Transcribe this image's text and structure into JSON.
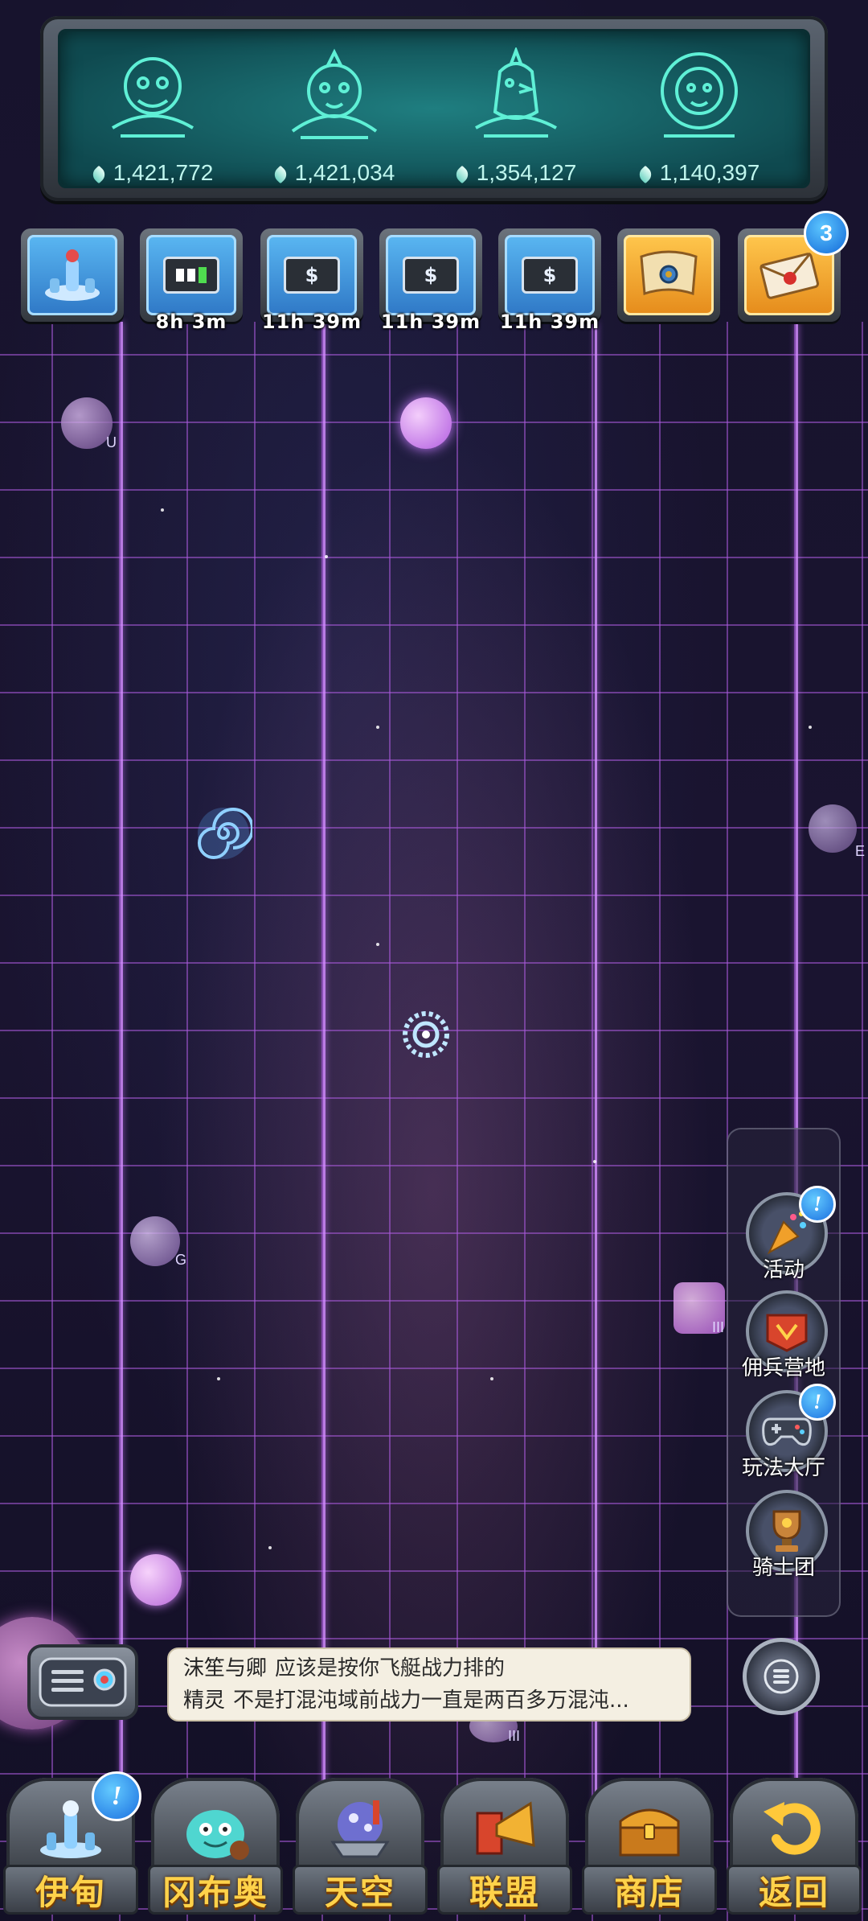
{
  "rankings": [
    {
      "emblem": "monkey-emblem",
      "power": "1,421,772"
    },
    {
      "emblem": "bear-emblem",
      "power": "1,421,034"
    },
    {
      "emblem": "bird-emblem",
      "power": "1,354,127"
    },
    {
      "emblem": "lion-emblem",
      "power": "1,140,397"
    }
  ],
  "tasks": [
    {
      "icon": "station-icon",
      "timer": ""
    },
    {
      "icon": "battery-charging-icon",
      "timer": "8h 3m"
    },
    {
      "icon": "battery-dollar-icon",
      "timer": "11h 39m",
      "symbol": "$"
    },
    {
      "icon": "battery-dollar-icon",
      "timer": "11h 39m",
      "symbol": "$"
    },
    {
      "icon": "battery-dollar-icon",
      "timer": "11h 39m",
      "symbol": "$"
    },
    {
      "icon": "treasure-map-icon",
      "timer": ""
    },
    {
      "icon": "mail-icon",
      "timer": "",
      "badge": "3"
    }
  ],
  "map": {
    "planets": [
      {
        "label": "U"
      },
      {
        "label": ""
      },
      {
        "label": "E"
      },
      {
        "label": "G"
      },
      {
        "label": "III"
      },
      {
        "label": ""
      },
      {
        "label": "III"
      }
    ]
  },
  "side_menu": [
    {
      "label": "活动",
      "icon": "party-popper-icon",
      "alert": "!"
    },
    {
      "label": "佣兵营地",
      "icon": "camp-flag-icon"
    },
    {
      "label": "玩法大厅",
      "icon": "gamepad-icon",
      "alert": "!"
    },
    {
      "label": "骑士团",
      "icon": "trophy-icon"
    }
  ],
  "chat": {
    "lines": [
      {
        "name": "沫笙与卿",
        "text": "应该是按你飞艇战力排的"
      },
      {
        "name": "精灵",
        "text": "不是打混沌域前战力一直是两百多万混沌..."
      }
    ]
  },
  "nav": [
    {
      "label": "伊甸",
      "icon": "eden-station-icon",
      "alert": "!"
    },
    {
      "label": "冈布奥",
      "icon": "gumball-icon"
    },
    {
      "label": "天空",
      "icon": "sky-ship-icon"
    },
    {
      "label": "联盟",
      "icon": "horn-icon"
    },
    {
      "label": "商店",
      "icon": "treasure-chest-icon"
    },
    {
      "label": "返回",
      "icon": "return-arrow-icon"
    }
  ],
  "colors": {
    "grid": "#aa5adc",
    "banner_teal": "#1f7e80",
    "nav_text": "#ffd24a",
    "badge_blue": "#1268d8"
  }
}
